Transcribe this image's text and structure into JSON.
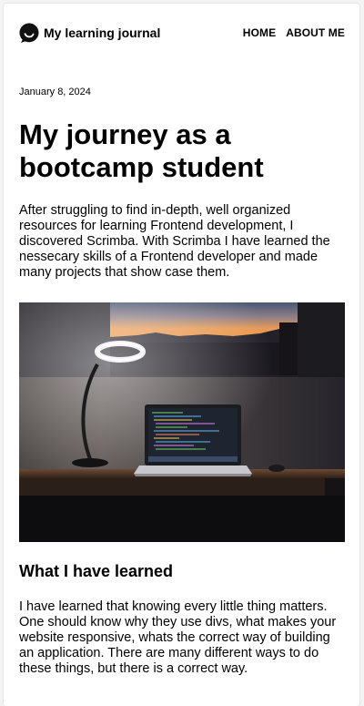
{
  "header": {
    "brand": "My learning journal",
    "logo_icon": "chat-bubble-icon",
    "nav": [
      "HOME",
      "ABOUT ME"
    ]
  },
  "post": {
    "date": "January 8, 2024",
    "title": "My journey as a bootcamp student",
    "intro": "After struggling to find in-depth, well organized resources for learning Frontend development, I discovered Scrimba. With Scrimba I have learned the nessecary skills of a Frontend developer and made many projects that show case them.",
    "image_alt": "Laptop on a desk next to a ring lamp in front of a window at sunset",
    "section_title": "What I have learned",
    "body": "I have learned that knowing every little thing matters. One should know why they use divs, what makes your website responsive, whats the correct way of building an application. There are many different ways to do these things, but there is a correct way."
  }
}
